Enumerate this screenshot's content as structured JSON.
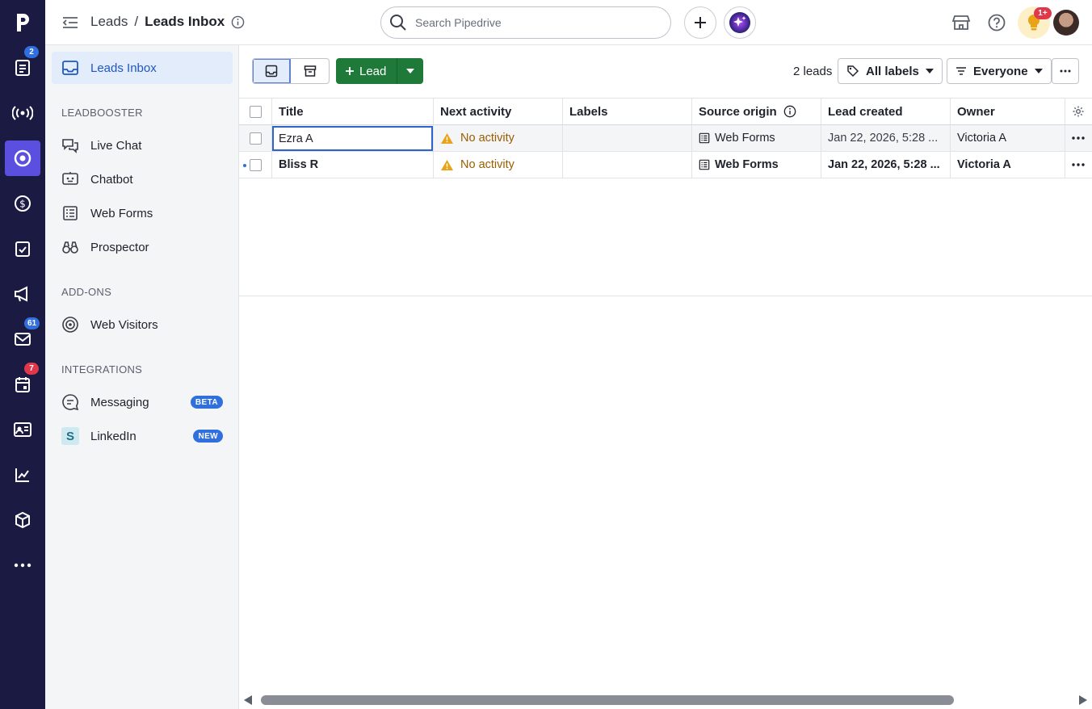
{
  "rail": {
    "badges": {
      "activity": "2",
      "mail": "61",
      "calendar": "7"
    }
  },
  "topbar": {
    "breadcrumb_parent": "Leads",
    "breadcrumb_sep": "/",
    "breadcrumb_current": "Leads Inbox",
    "search_placeholder": "Search Pipedrive",
    "tips_badge": "1+"
  },
  "sidebar": {
    "active_item": "Leads Inbox",
    "sections": {
      "leadbooster": "LEADBOOSTER",
      "addons": "ADD-ONS",
      "integrations": "INTEGRATIONS"
    },
    "leadbooster_items": [
      "Live Chat",
      "Chatbot",
      "Web Forms",
      "Prospector"
    ],
    "addons_items": [
      "Web Visitors"
    ],
    "integrations_items": [
      {
        "label": "Messaging",
        "tag": "BETA"
      },
      {
        "label": "LinkedIn",
        "tag": "NEW"
      }
    ]
  },
  "toolbar": {
    "add_lead_label": "Lead",
    "lead_count": "2 leads",
    "labels_filter": "All labels",
    "owner_filter": "Everyone"
  },
  "table": {
    "columns": [
      "Title",
      "Next activity",
      "Labels",
      "Source origin",
      "Lead created",
      "Owner"
    ],
    "rows": [
      {
        "title": "Ezra A",
        "next_activity": "No activity",
        "labels": "",
        "source": "Web Forms",
        "created": "Jan 22, 2026, 5:28 ...",
        "owner": "Victoria A"
      },
      {
        "title": "Bliss R",
        "next_activity": "No activity",
        "labels": "",
        "source": "Web Forms",
        "created": "Jan 22, 2026, 5:28 ...",
        "owner": "Victoria A"
      }
    ]
  },
  "colors": {
    "rail_bg": "#1b1a43",
    "accent": "#5b4fe0",
    "primary_green": "#1f7a3a",
    "link_blue": "#1d57c6",
    "warning": "#e8a317"
  }
}
